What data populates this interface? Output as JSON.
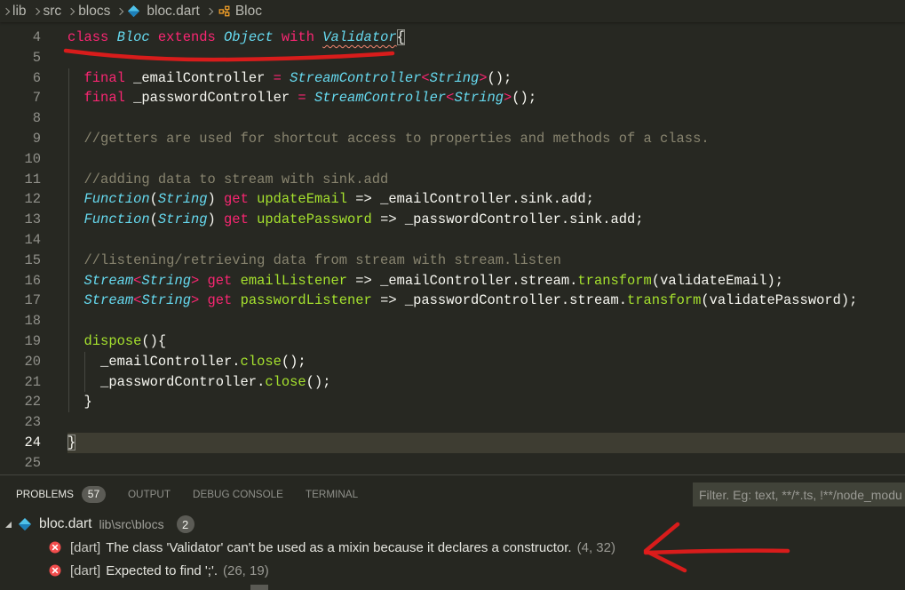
{
  "breadcrumb": {
    "items": [
      {
        "label": "lib"
      },
      {
        "label": "src"
      },
      {
        "label": "blocs"
      },
      {
        "label": "bloc.dart",
        "icon": "dart-file-icon"
      },
      {
        "label": "Bloc",
        "icon": "class-symbol-icon"
      }
    ]
  },
  "editor": {
    "lines": [
      {
        "number": "4",
        "tokens": [
          {
            "text": "class",
            "color": "#f92672"
          },
          {
            "text": " "
          },
          {
            "text": "Bloc",
            "color": "#66d9ef",
            "italic": true
          },
          {
            "text": " "
          },
          {
            "text": "extends",
            "color": "#f92672"
          },
          {
            "text": " "
          },
          {
            "text": "Object",
            "color": "#66d9ef",
            "italic": true
          },
          {
            "text": " "
          },
          {
            "text": "with",
            "color": "#f92672"
          },
          {
            "text": " "
          },
          {
            "text": "Validator",
            "color": "#66d9ef",
            "italic": true,
            "error": true
          },
          {
            "text": "{",
            "bracket_match": true
          }
        ]
      },
      {
        "number": "5",
        "tokens": []
      },
      {
        "number": "6",
        "tokens": [
          {
            "text": "  "
          },
          {
            "text": "final",
            "color": "#f92672"
          },
          {
            "text": " _emailController "
          },
          {
            "text": "=",
            "color": "#f92672"
          },
          {
            "text": " "
          },
          {
            "text": "StreamController",
            "color": "#66d9ef",
            "italic": true
          },
          {
            "text": "<",
            "color": "#f92672"
          },
          {
            "text": "String",
            "color": "#66d9ef",
            "italic": true
          },
          {
            "text": ">",
            "color": "#f92672"
          },
          {
            "text": "();"
          }
        ]
      },
      {
        "number": "7",
        "tokens": [
          {
            "text": "  "
          },
          {
            "text": "final",
            "color": "#f92672"
          },
          {
            "text": " _passwordController "
          },
          {
            "text": "=",
            "color": "#f92672"
          },
          {
            "text": " "
          },
          {
            "text": "StreamController",
            "color": "#66d9ef",
            "italic": true
          },
          {
            "text": "<",
            "color": "#f92672"
          },
          {
            "text": "String",
            "color": "#66d9ef",
            "italic": true
          },
          {
            "text": ">",
            "color": "#f92672"
          },
          {
            "text": "();"
          }
        ]
      },
      {
        "number": "8",
        "tokens": []
      },
      {
        "number": "9",
        "tokens": [
          {
            "text": "  "
          },
          {
            "text": "//getters are used for shortcut access to properties and methods of a class.",
            "color": "#88846f"
          }
        ]
      },
      {
        "number": "10",
        "tokens": []
      },
      {
        "number": "11",
        "tokens": [
          {
            "text": "  "
          },
          {
            "text": "//adding data to stream with sink.add",
            "color": "#88846f"
          }
        ]
      },
      {
        "number": "12",
        "tokens": [
          {
            "text": "  "
          },
          {
            "text": "Function",
            "color": "#66d9ef",
            "italic": true
          },
          {
            "text": "("
          },
          {
            "text": "String",
            "color": "#66d9ef",
            "italic": true
          },
          {
            "text": ") "
          },
          {
            "text": "get",
            "color": "#f92672"
          },
          {
            "text": " "
          },
          {
            "text": "updateEmail",
            "color": "#a6e22e"
          },
          {
            "text": " => _emailController.sink.add;"
          }
        ]
      },
      {
        "number": "13",
        "tokens": [
          {
            "text": "  "
          },
          {
            "text": "Function",
            "color": "#66d9ef",
            "italic": true
          },
          {
            "text": "("
          },
          {
            "text": "String",
            "color": "#66d9ef",
            "italic": true
          },
          {
            "text": ") "
          },
          {
            "text": "get",
            "color": "#f92672"
          },
          {
            "text": " "
          },
          {
            "text": "updatePassword",
            "color": "#a6e22e"
          },
          {
            "text": " => _passwordController.sink.add;"
          }
        ]
      },
      {
        "number": "14",
        "tokens": []
      },
      {
        "number": "15",
        "tokens": [
          {
            "text": "  "
          },
          {
            "text": "//listening/retrieving data from stream with stream.listen",
            "color": "#88846f"
          }
        ]
      },
      {
        "number": "16",
        "tokens": [
          {
            "text": "  "
          },
          {
            "text": "Stream",
            "color": "#66d9ef",
            "italic": true
          },
          {
            "text": "<",
            "color": "#f92672"
          },
          {
            "text": "String",
            "color": "#66d9ef",
            "italic": true
          },
          {
            "text": ">",
            "color": "#f92672"
          },
          {
            "text": " "
          },
          {
            "text": "get",
            "color": "#f92672"
          },
          {
            "text": " "
          },
          {
            "text": "emailListener",
            "color": "#a6e22e"
          },
          {
            "text": " => _emailController.stream."
          },
          {
            "text": "transform",
            "color": "#a6e22e"
          },
          {
            "text": "(validateEmail);"
          }
        ]
      },
      {
        "number": "17",
        "tokens": [
          {
            "text": "  "
          },
          {
            "text": "Stream",
            "color": "#66d9ef",
            "italic": true
          },
          {
            "text": "<",
            "color": "#f92672"
          },
          {
            "text": "String",
            "color": "#66d9ef",
            "italic": true
          },
          {
            "text": ">",
            "color": "#f92672"
          },
          {
            "text": " "
          },
          {
            "text": "get",
            "color": "#f92672"
          },
          {
            "text": " "
          },
          {
            "text": "passwordListener",
            "color": "#a6e22e"
          },
          {
            "text": " => _passwordController.stream."
          },
          {
            "text": "transform",
            "color": "#a6e22e"
          },
          {
            "text": "(validatePassword);"
          }
        ]
      },
      {
        "number": "18",
        "tokens": []
      },
      {
        "number": "19",
        "tokens": [
          {
            "text": "  "
          },
          {
            "text": "dispose",
            "color": "#a6e22e"
          },
          {
            "text": "(){"
          }
        ]
      },
      {
        "number": "20",
        "tokens": [
          {
            "text": "    _emailController."
          },
          {
            "text": "close",
            "color": "#a6e22e"
          },
          {
            "text": "();"
          }
        ]
      },
      {
        "number": "21",
        "tokens": [
          {
            "text": "    _passwordController."
          },
          {
            "text": "close",
            "color": "#a6e22e"
          },
          {
            "text": "();"
          }
        ]
      },
      {
        "number": "22",
        "tokens": [
          {
            "text": "  }"
          }
        ]
      },
      {
        "number": "23",
        "tokens": []
      },
      {
        "number": "24",
        "current": true,
        "tokens": [
          {
            "text": "}",
            "bracket_match": true
          }
        ]
      },
      {
        "number": "25",
        "tokens": []
      }
    ]
  },
  "panel": {
    "tabs": [
      {
        "label": "PROBLEMS",
        "badge": "57",
        "active": true
      },
      {
        "label": "OUTPUT"
      },
      {
        "label": "DEBUG CONSOLE"
      },
      {
        "label": "TERMINAL"
      }
    ],
    "filter_placeholder": "Filter. Eg: text, **/*.ts, !**/node_modu",
    "file_group": {
      "file": "bloc.dart",
      "path": "lib\\src\\blocs",
      "count": "2",
      "icon": "dart-file-icon",
      "expanded": true
    },
    "problems": [
      {
        "icon": "error-icon",
        "source": "[dart]",
        "message": "The class 'Validator' can't be used as a mixin because it declares a constructor.",
        "position": "(4, 32)"
      },
      {
        "icon": "error-icon",
        "source": "[dart]",
        "message": "Expected to find ';'.",
        "position": "(26, 19)"
      }
    ]
  },
  "colors": {
    "error_icon": "#f14c4c",
    "annotation": "#e21b1b",
    "current_line": "#3e3d32"
  }
}
